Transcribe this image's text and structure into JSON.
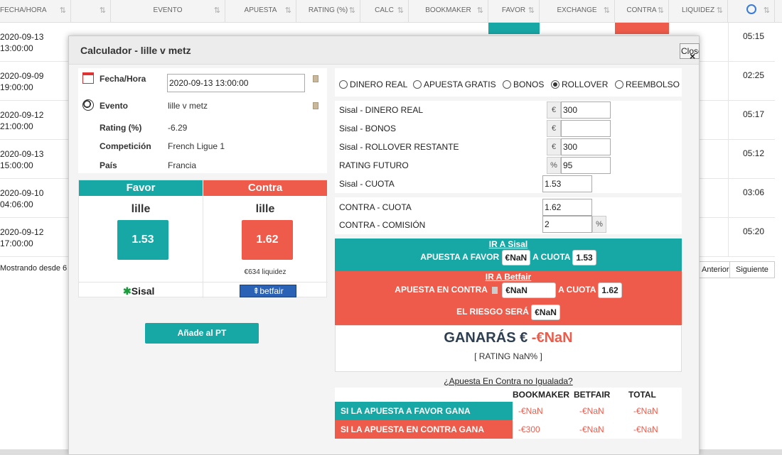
{
  "background": {
    "headers": [
      "FECHA/HORA",
      "",
      "EVENTO",
      "APUESTA",
      "RATING (%)",
      "CALC",
      "BOOKMAKER",
      "FAVOR",
      "EXCHANGE",
      "CONTRA",
      "LIQUIDEZ"
    ],
    "rows": [
      {
        "date": "2020-09-13",
        "time": "13:00:00",
        "hour": "05:15"
      },
      {
        "date": "2020-09-09",
        "time": "19:00:00",
        "hour": "02:25"
      },
      {
        "date": "2020-09-12",
        "time": "21:00:00",
        "hour": "05:17"
      },
      {
        "date": "2020-09-13",
        "time": "15:00:00",
        "hour": "05:12"
      },
      {
        "date": "2020-09-10",
        "time": "04:06:00",
        "hour": "03:06"
      },
      {
        "date": "2020-09-12",
        "time": "17:00:00",
        "hour": "05:20"
      }
    ],
    "footer_text": "Mostrando desde 6",
    "prev_label": "Anterior",
    "next_label": "Siguiente"
  },
  "modal": {
    "title": "Calculador - lille v metz",
    "close_label": "Close",
    "info": {
      "fecha_label": "Fecha/Hora",
      "fecha_value": "2020-09-13 13:00:00",
      "evento_label": "Evento",
      "evento_value": "lille v metz",
      "rating_label": "Rating (%)",
      "rating_value": "-6.29",
      "competicion_label": "Competición",
      "competicion_value": "French Ligue 1",
      "pais_label": "País",
      "pais_value": "Francia"
    },
    "favor": {
      "header": "Favor",
      "team": "lille",
      "odds": "1.53",
      "bookmaker": "Sisal"
    },
    "contra": {
      "header": "Contra",
      "team": "lille",
      "odds": "1.62",
      "liquidity": "€634 liquidez",
      "exchange": "betfair"
    },
    "add_button": "Añade al PT",
    "modes": [
      "DINERO REAL",
      "APUESTA GRATIS",
      "BONOS",
      "ROLLOVER",
      "REEMBOLSO"
    ],
    "selected_mode": "ROLLOVER",
    "fields": {
      "dinero_real_label": "Sisal - DINERO REAL",
      "dinero_real_value": "300",
      "bonos_label": "Sisal - BONOS",
      "bonos_value": "",
      "rollover_label": "Sisal - ROLLOVER RESTANTE",
      "rollover_value": "300",
      "rating_futuro_label": "RATING FUTURO",
      "rating_futuro_value": "95",
      "cuota_label": "Sisal - CUOTA",
      "cuota_value": "1.53",
      "contra_cuota_label": "CONTRA - CUOTA",
      "contra_cuota_value": "1.62",
      "contra_comision_label": "CONTRA - COMISIÓN",
      "contra_comision_value": "2",
      "euro": "€",
      "percent": "%"
    },
    "results": {
      "ir_sisal": "IR A Sisal",
      "apuesta_favor_label": "APUESTA A FAVOR",
      "apuesta_favor_value": "€NaN",
      "a_cuota_label": "A CUOTA",
      "favor_cuota": "1.53",
      "ir_betfair": "IR A Betfair",
      "apuesta_contra_label": "APUESTA EN CONTRA",
      "apuesta_contra_value": "€NaN",
      "contra_cuota": "1.62",
      "riesgo_label": "EL RIESGO SERÁ",
      "riesgo_value": "€NaN",
      "ganaras_label": "GANARÁS €",
      "ganaras_value": "-€NaN",
      "rating_text": "[ RATING NaN% ]",
      "no_igualada_link": "¿Apuesta En Contra no Igualada?"
    },
    "table": {
      "headers": [
        "BOOKMAKER",
        "BETFAIR",
        "TOTAL"
      ],
      "rows": [
        {
          "label": "SI LA APUESTA A FAVOR GANA",
          "bookmaker": "-€NaN",
          "betfair": "-€NaN",
          "total": "-€NaN"
        },
        {
          "label": "SI LA APUESTA EN CONTRA GANA",
          "bookmaker": "-€300",
          "betfair": "-€NaN",
          "total": "-€NaN"
        }
      ]
    },
    "colors": {
      "teal": "#17a7a5",
      "red": "#ee5b4b"
    }
  }
}
